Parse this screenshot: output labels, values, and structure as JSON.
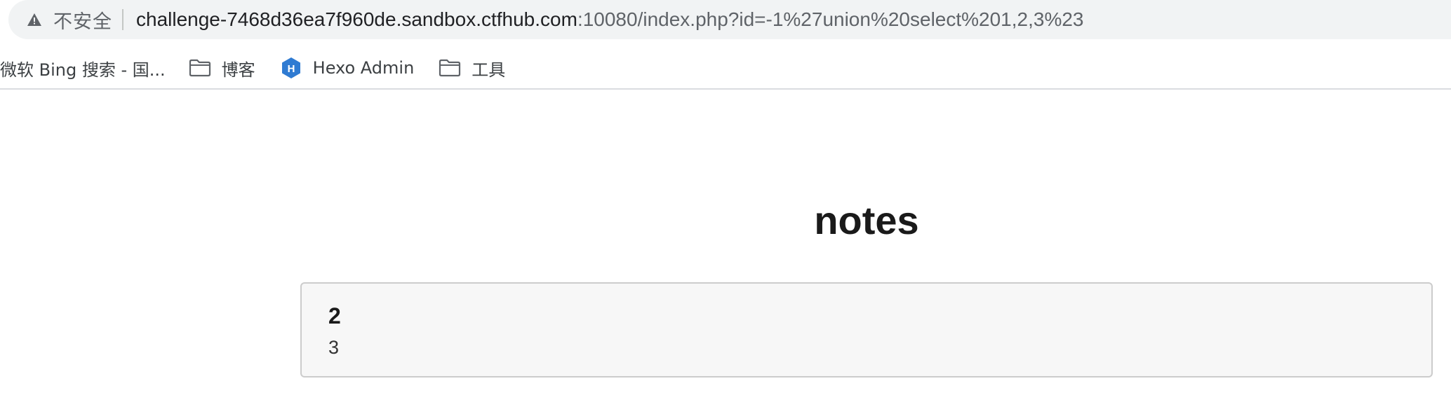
{
  "browser": {
    "security_label": "不安全",
    "url_host": "challenge-7468d36ea7f960de.sandbox.ctfhub.com",
    "url_rest": ":10080/index.php?id=-1%27union%20select%201,2,3%23",
    "warning_icon": "warning-triangle-icon"
  },
  "bookmarks": [
    {
      "label": "微软 Bing 搜索 - 国...",
      "icon": "none"
    },
    {
      "label": "博客",
      "icon": "folder-icon"
    },
    {
      "label": "Hexo Admin",
      "icon": "hexo-icon"
    },
    {
      "label": "工具",
      "icon": "folder-icon"
    }
  ],
  "page": {
    "title": "notes",
    "notes": [
      {
        "title": "2",
        "body": "3"
      }
    ]
  },
  "colors": {
    "address_bar_bg": "#f1f3f4",
    "hexo_blue": "#2f7bd2",
    "card_bg": "#f7f7f7",
    "card_border": "#cccccc"
  }
}
